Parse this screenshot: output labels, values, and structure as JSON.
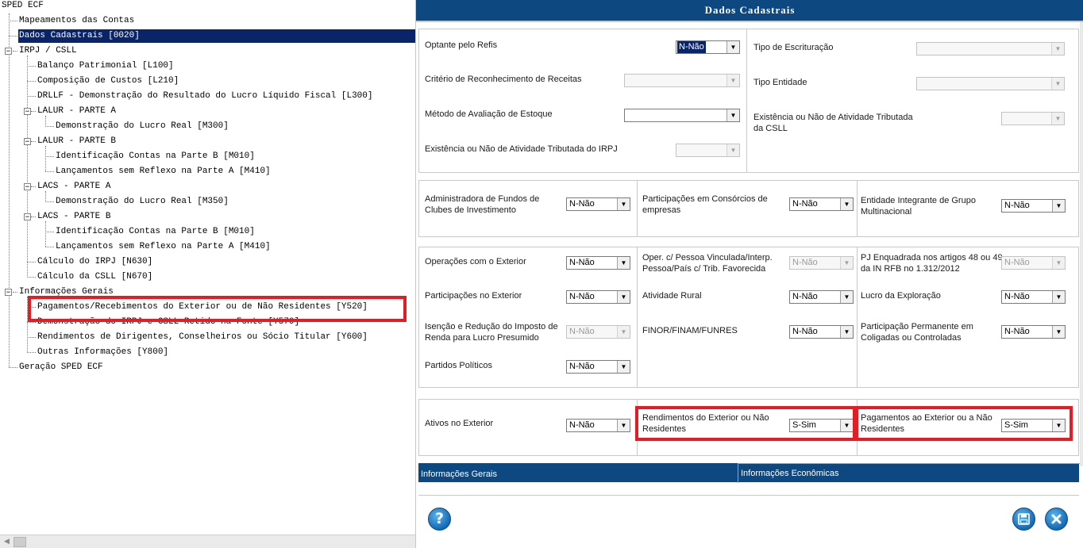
{
  "tree": {
    "items": [
      {
        "label": "SPED ECF"
      },
      {
        "label": "Mapeamentos das Contas"
      },
      {
        "label": "Dados Cadastrais [0020]"
      },
      {
        "label": "IRPJ / CSLL"
      },
      {
        "label": "Balanço Patrimonial [L100]"
      },
      {
        "label": "Composição de Custos [L210]"
      },
      {
        "label": "DRLLF - Demonstração do Resultado do Lucro Líquido Fiscal [L300]"
      },
      {
        "label": "LALUR - PARTE A"
      },
      {
        "label": "Demonstração do Lucro Real [M300]"
      },
      {
        "label": "LALUR - PARTE B"
      },
      {
        "label": "Identificação Contas na Parte B [M010]"
      },
      {
        "label": "Lançamentos sem Reflexo na Parte A [M410]"
      },
      {
        "label": "LACS - PARTE A"
      },
      {
        "label": "Demonstração do Lucro Real [M350]"
      },
      {
        "label": "LACS - PARTE B"
      },
      {
        "label": "Identificação Contas na Parte B [M010]"
      },
      {
        "label": "Lançamentos sem Reflexo na Parte A [M410]"
      },
      {
        "label": "Cálculo do IRPJ [N630]"
      },
      {
        "label": "Cálculo da CSLL [N670]"
      },
      {
        "label": "Informações Gerais"
      },
      {
        "label": "Pagamentos/Recebimentos do Exterior ou de Não Residentes [Y520]"
      },
      {
        "label": "Demonstração do IRPJ e CSLL Retido na Fonte [Y570]"
      },
      {
        "label": "Rendimentos de Dirigentes, Conselheiros ou Sócio Titular [Y600]"
      },
      {
        "label": "Outras Informações [Y800]"
      },
      {
        "label": "Geração SPED ECF"
      }
    ]
  },
  "dialog": {
    "title": "Dados Cadastrais",
    "fields": {
      "optante_refis": {
        "label": "Optante pelo Refis",
        "value": "N-Não"
      },
      "criterio_receitas": {
        "label": "Critério de Reconhecimento de Receitas",
        "value": ""
      },
      "metodo_estoque": {
        "label": "Método de Avaliação de Estoque",
        "value": ""
      },
      "atividade_irpj": {
        "label": "Existência ou Não de Atividade Tributada do IRPJ",
        "value": ""
      },
      "tipo_escrituracao": {
        "label": "Tipo de Escrituração",
        "value": ""
      },
      "tipo_entidade": {
        "label": "Tipo Entidade",
        "value": ""
      },
      "atividade_csll": {
        "label": "Existência ou Não de Atividade Tributada da CSLL",
        "value": ""
      },
      "adm_fundos": {
        "label": "Administradora de Fundos de Clubes de Investimento",
        "value": "N-Não"
      },
      "consorcios": {
        "label": "Participações em Consórcios de empresas",
        "value": "N-Não"
      },
      "grupo_multinacional": {
        "label": "Entidade Integrante de Grupo Multinacional",
        "value": "N-Não"
      },
      "operacoes_exterior": {
        "label": "Operações com o Exterior",
        "value": "N-Não"
      },
      "pessoa_vinculada": {
        "label": "Oper. c/ Pessoa Vinculada/Interp. Pessoa/País c/ Trib. Favorecida",
        "value": "N-Não"
      },
      "pj_enquadrada": {
        "label": "PJ Enquadrada nos artigos 48 ou 49 da IN RFB no 1.312/2012",
        "value": "N-Não"
      },
      "participacoes_exterior": {
        "label": "Participações no Exterior",
        "value": "N-Não"
      },
      "atividade_rural": {
        "label": "Atividade Rural",
        "value": "N-Não"
      },
      "lucro_exploracao": {
        "label": "Lucro da Exploração",
        "value": "N-Não"
      },
      "isencao_reducao": {
        "label": "Isenção e Redução do Imposto de Renda para Lucro Presumido",
        "value": "N-Não"
      },
      "finor": {
        "label": "FINOR/FINAM/FUNRES",
        "value": "N-Não"
      },
      "participacao_permanente": {
        "label": "Participação Permanente em Coligadas ou Controladas",
        "value": "N-Não"
      },
      "partidos_politicos": {
        "label": "Partidos Políticos",
        "value": "N-Não"
      },
      "ativos_exterior": {
        "label": "Ativos no Exterior",
        "value": "N-Não"
      },
      "rendimentos_exterior": {
        "label": "Rendimentos do Exterior ou Não Residentes",
        "value": "S-Sim"
      },
      "pagamentos_exterior": {
        "label": "Pagamentos ao Exterior ou a Não Residentes",
        "value": "S-Sim"
      }
    },
    "tabs": [
      {
        "label": "Informações Gerais"
      },
      {
        "label": "Informações Econômicas"
      }
    ],
    "buttons": {
      "help_icon": "question-mark-icon",
      "save_icon": "floppy-disk-icon",
      "close_icon": "close-x-icon"
    }
  },
  "colors": {
    "title_bar": "#0d4880",
    "selection": "#0a246a",
    "highlight_box": "#e41c24"
  }
}
